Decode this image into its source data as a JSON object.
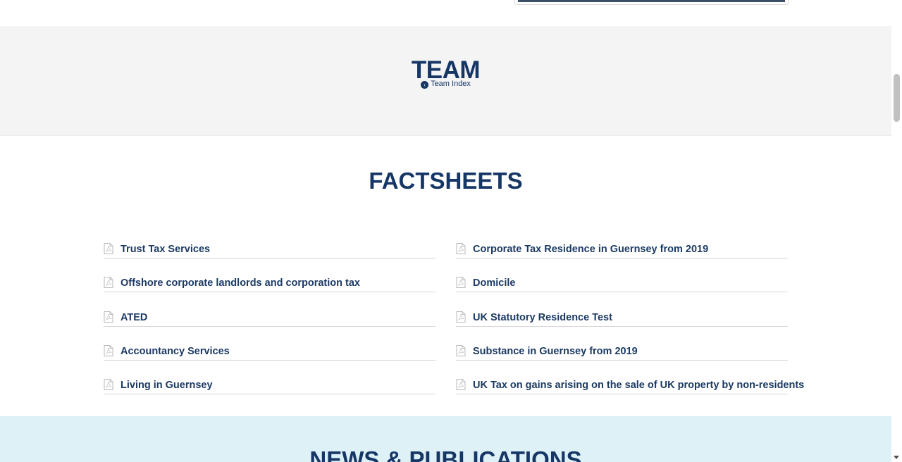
{
  "team": {
    "title": "TEAM",
    "index_link": "Team Index"
  },
  "factsheets": {
    "title": "FACTSHEETS",
    "left_items": [
      {
        "label": "Trust Tax Services",
        "icon": "pdf-file-icon"
      },
      {
        "label": "Offshore corporate landlords and corporation tax",
        "icon": "pdf-file-icon"
      },
      {
        "label": "ATED",
        "icon": "pdf-file-icon"
      },
      {
        "label": "Accountancy Services",
        "icon": "pdf-file-icon"
      },
      {
        "label": "Living in Guernsey",
        "icon": "pdf-file-icon"
      }
    ],
    "right_items": [
      {
        "label": "Corporate Tax Residence in Guernsey from 2019",
        "icon": "pdf-file-icon"
      },
      {
        "label": "Domicile",
        "icon": "pdf-file-icon"
      },
      {
        "label": "UK Statutory Residence Test",
        "icon": "pdf-file-icon"
      },
      {
        "label": "Substance in Guernsey from 2019",
        "icon": "pdf-file-icon"
      },
      {
        "label": "UK Tax on gains arising on the sale of UK property by non-residents",
        "icon": "pdf-file-icon"
      }
    ]
  },
  "news": {
    "title": "NEWS & PUBLICATIONS"
  },
  "colors": {
    "brand_navy": "#163766",
    "team_band_bg": "#f4f4f4",
    "news_band_bg": "#def1f7",
    "divider": "#d6d6d6"
  }
}
